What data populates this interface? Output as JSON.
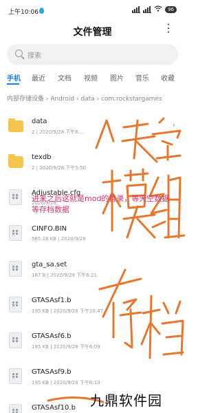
{
  "status_bar": {
    "time": "上午10:06",
    "battery": "96"
  },
  "header": {
    "title": "文件管理",
    "more": "⋮"
  },
  "search": {
    "placeholder": "搜索"
  },
  "tabs": [
    {
      "label": "手机",
      "active": true
    },
    {
      "label": "最近"
    },
    {
      "label": "文档"
    },
    {
      "label": "视频"
    },
    {
      "label": "图片"
    },
    {
      "label": "音乐"
    },
    {
      "label": "收藏"
    }
  ],
  "breadcrumb": "内部存储设备 › Android › data › com.rockstargames",
  "files": [
    {
      "type": "folder",
      "name": "data",
      "meta": "2 | 2020/9/28 下午6:..."
    },
    {
      "type": "folder",
      "name": "texdb",
      "meta": "2 | 2020/9/28 下午5:50"
    },
    {
      "type": "file",
      "name": "Adjustable.cfg",
      "meta": "2020/9/28"
    },
    {
      "type": "file",
      "name": "CINFO.BIN",
      "meta": "565.18 KB | 2020/9/28"
    },
    {
      "type": "file",
      "name": "gta_sa.set",
      "meta": "167 B | 2020/9/28 下午6:21"
    },
    {
      "type": "file",
      "name": "GTASAsf1.b",
      "meta": "195 KB | 2020/9/28 下午10:47"
    },
    {
      "type": "file",
      "name": "GTASAsf6.b",
      "meta": "195 KB | 2020/9/28 下午6:09"
    },
    {
      "type": "file",
      "name": "GTASAsf9.b",
      "meta": "195 KB | 2020/9/28 下午6:13"
    },
    {
      "type": "file",
      "name": "GTASAsf10.b",
      "meta": ""
    }
  ],
  "overlay_text": "进来之后这就是mod的目录，等天空数据等存档数据",
  "watermark": "九鼎软件园",
  "annotation_color": "#e8772e"
}
